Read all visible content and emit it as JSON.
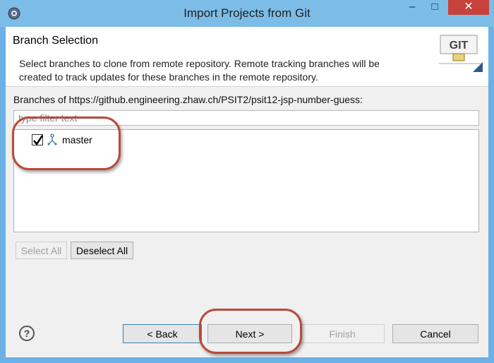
{
  "window": {
    "title": "Import Projects from Git",
    "minimize_glyph": "–",
    "maximize_glyph": "□",
    "close_glyph": "✕"
  },
  "header": {
    "title": "Branch Selection",
    "description": "Select branches to clone from remote repository. Remote tracking branches will be created to track updates for these branches in the remote repository.",
    "banner_text": "GIT"
  },
  "branches": {
    "label": "Branches of https://github.engineering.zhaw.ch/PSIT2/psit12-jsp-number-guess:",
    "filter_placeholder": "type filter text",
    "items": [
      {
        "name": "master",
        "checked": true,
        "icon": "branch-icon"
      }
    ]
  },
  "buttons": {
    "select_all": "Select All",
    "deselect_all": "Deselect All",
    "help": "?",
    "back": "< Back",
    "next": "Next >",
    "finish": "Finish",
    "cancel": "Cancel"
  },
  "colors": {
    "titlebar": "#7cbde8",
    "close": "#c7423a",
    "annotation": "#b84a3b"
  }
}
